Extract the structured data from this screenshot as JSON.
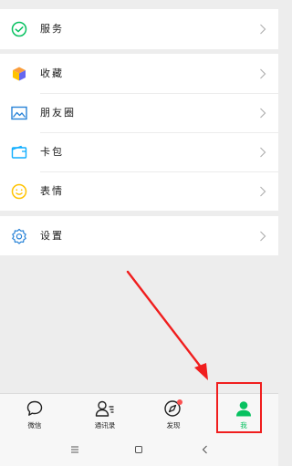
{
  "menu": {
    "services": "服务",
    "favorites": "收藏",
    "moments": "朋友圈",
    "cards": "卡包",
    "stickers": "表情",
    "settings": "设置"
  },
  "tabs": {
    "chats": "微信",
    "contacts": "通讯录",
    "discover": "发现",
    "me": "我"
  },
  "colors": {
    "accent_green": "#07c160",
    "annotation_red": "#f01e1e",
    "discover_badge": "#fa5151"
  },
  "icons": {
    "services": "wechat-pay-icon",
    "favorites": "cube-icon",
    "moments": "picture-icon",
    "cards": "wallet-icon",
    "stickers": "smiley-icon",
    "settings": "gear-icon",
    "chats": "chat-bubble-icon",
    "contacts": "contacts-icon",
    "discover": "compass-icon",
    "me": "person-icon",
    "nav_menu": "menu-lines-icon",
    "nav_home": "square-icon",
    "nav_back": "back-chevron-icon"
  }
}
